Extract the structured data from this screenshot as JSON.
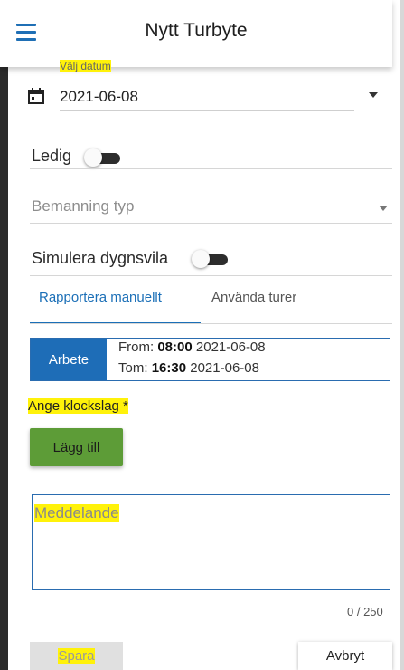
{
  "header": {
    "title": "Nytt Turbyte",
    "menu_icon": "hamburger-menu-icon"
  },
  "date_field": {
    "label": "Välj datum",
    "value": "2021-06-08",
    "icon": "calendar-icon"
  },
  "ledig": {
    "label": "Ledig",
    "checked": false
  },
  "bemanning": {
    "placeholder": "Bemanning typ"
  },
  "simulera": {
    "label": "Simulera dygnsvila",
    "checked": false
  },
  "tabs": [
    {
      "label": "Rapportera manuellt",
      "active": true
    },
    {
      "label": "Använda turer",
      "active": false
    }
  ],
  "shift": {
    "type": "Arbete",
    "from_label": "From:",
    "from_time": "08:00",
    "from_date": "2021-06-08",
    "to_label": "Tom:",
    "to_time": "16:30",
    "to_date": "2021-06-08"
  },
  "time_section": {
    "label": "Ange klockslag *"
  },
  "add_button": {
    "label": "Lägg till"
  },
  "message": {
    "placeholder": "Meddelande",
    "counter": "0 / 250"
  },
  "footer": {
    "save_label": "Spara",
    "cancel_label": "Avbryt"
  },
  "colors": {
    "primary": "#1e6db7",
    "add_button": "#5d9c37",
    "highlight": "#fff20a"
  }
}
